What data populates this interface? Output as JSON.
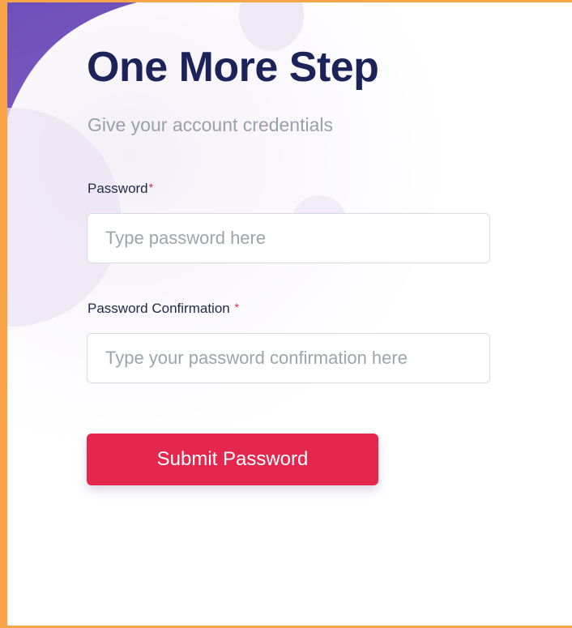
{
  "form": {
    "title": "One More Step",
    "subtitle": "Give your account credentials",
    "password": {
      "label": "Password",
      "required_mark": "*",
      "placeholder": "Type password here",
      "value": ""
    },
    "password_confirmation": {
      "label": "Password Confirmation",
      "required_mark": "*",
      "placeholder": "Type your password confirmation here",
      "value": ""
    },
    "submit_label": "Submit Password"
  },
  "colors": {
    "title": "#1b2359",
    "accent_button": "#e5274e",
    "required": "#e3284a",
    "frame_border": "#f9a449",
    "decor_purple": "#6a4fb8"
  }
}
